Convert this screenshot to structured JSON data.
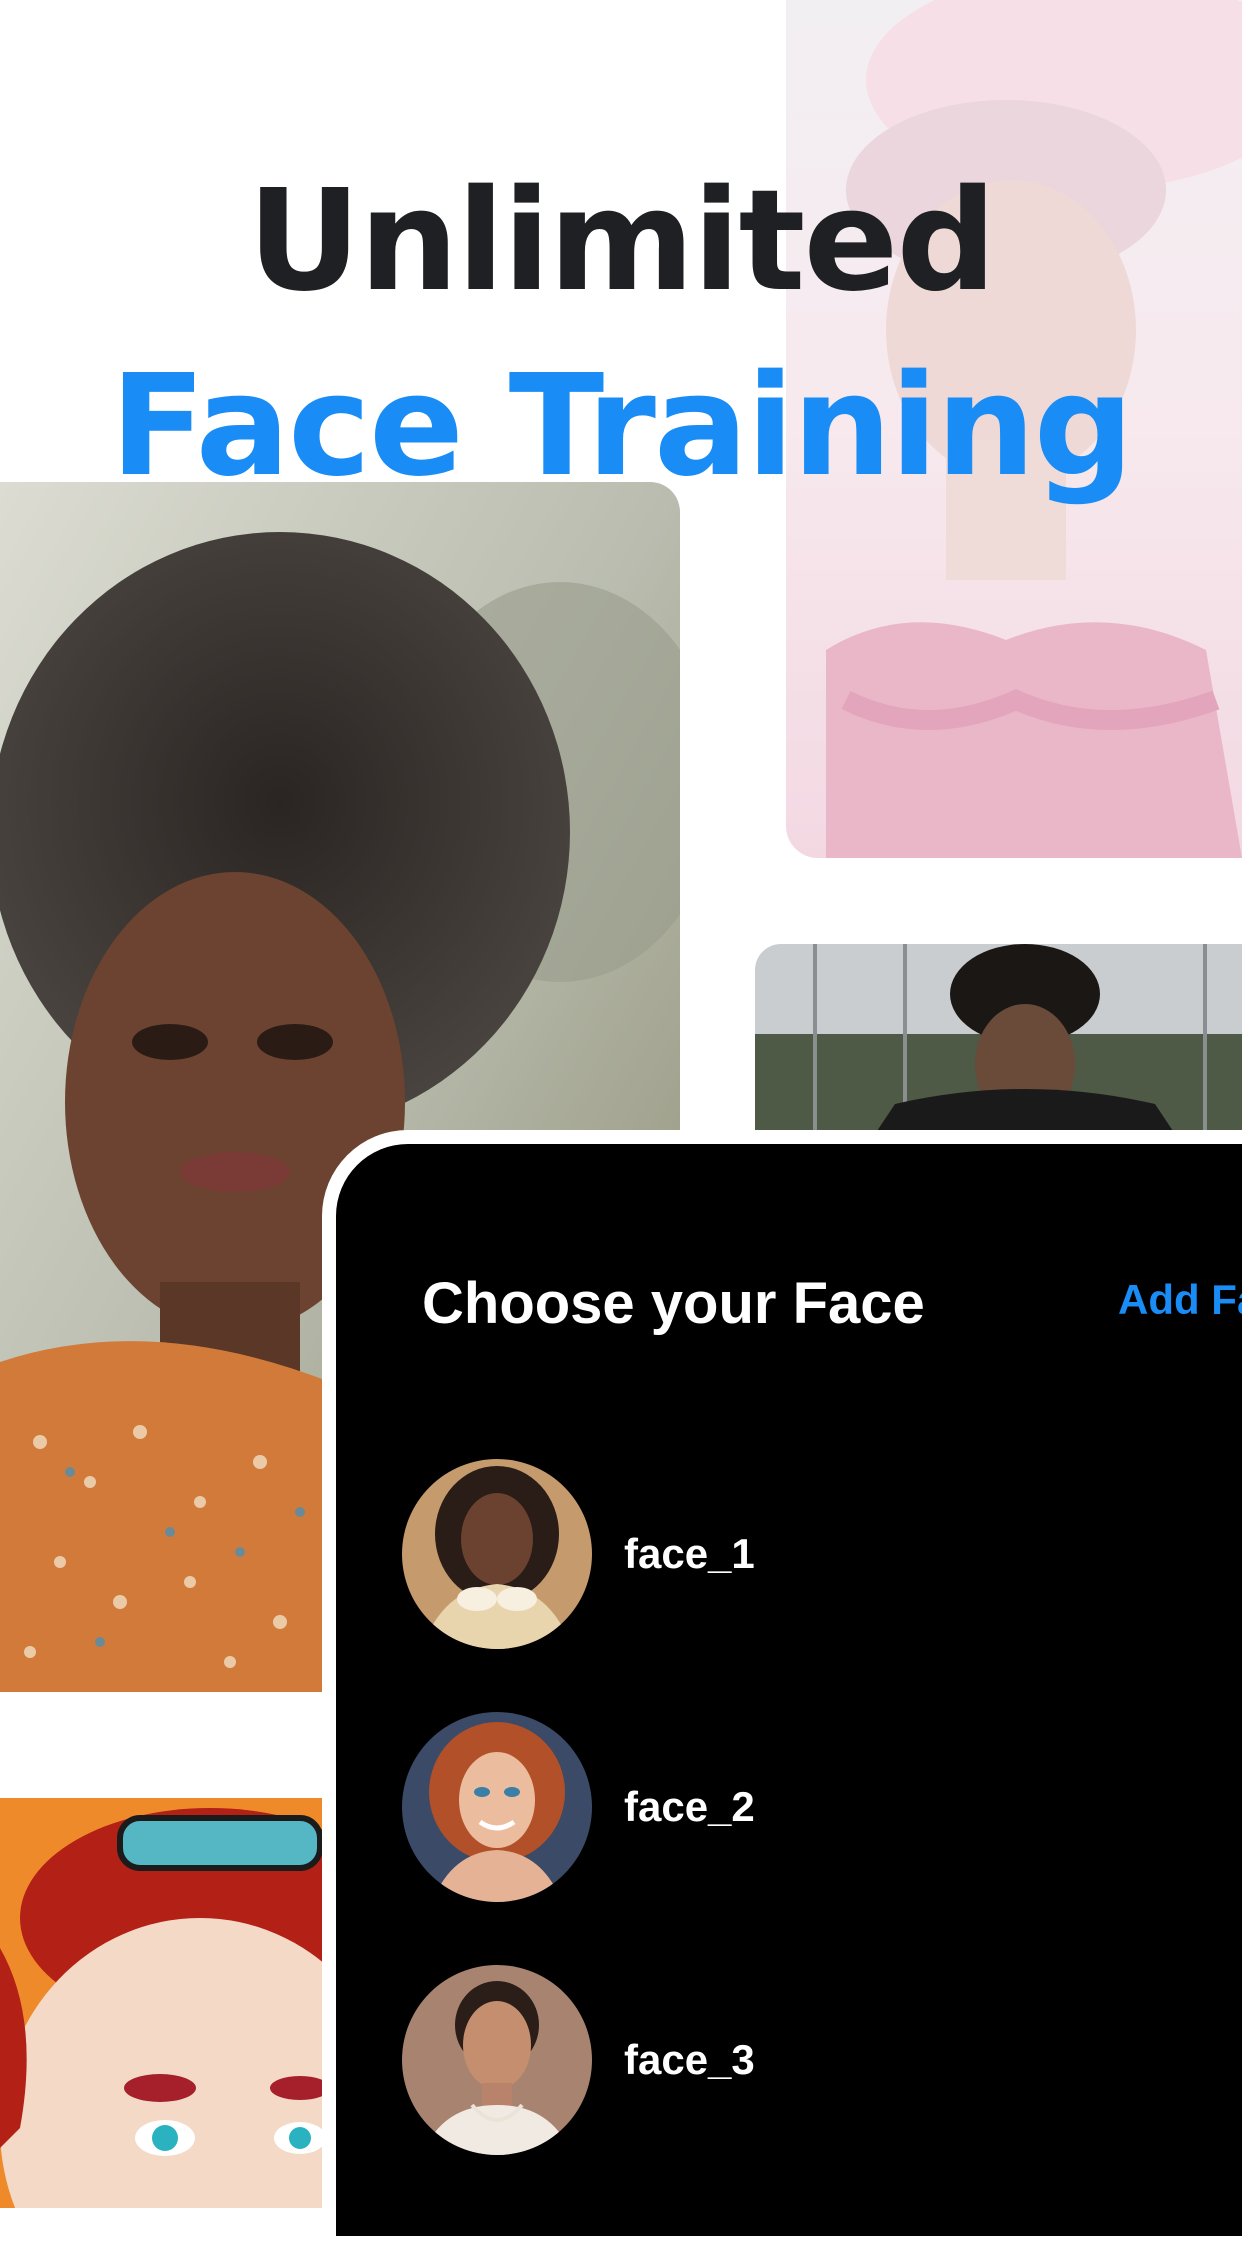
{
  "headline": {
    "line1": "Unlimited",
    "line2": "Face Training"
  },
  "colors": {
    "accent": "#1a8cf5",
    "headline_dark": "#1f2023",
    "panel_bg": "#000000"
  },
  "panel": {
    "title": "Choose your Face",
    "add_button_label": "Add Fa"
  },
  "faces": [
    {
      "label": "face_1"
    },
    {
      "label": "face_2"
    },
    {
      "label": "face_3"
    }
  ]
}
